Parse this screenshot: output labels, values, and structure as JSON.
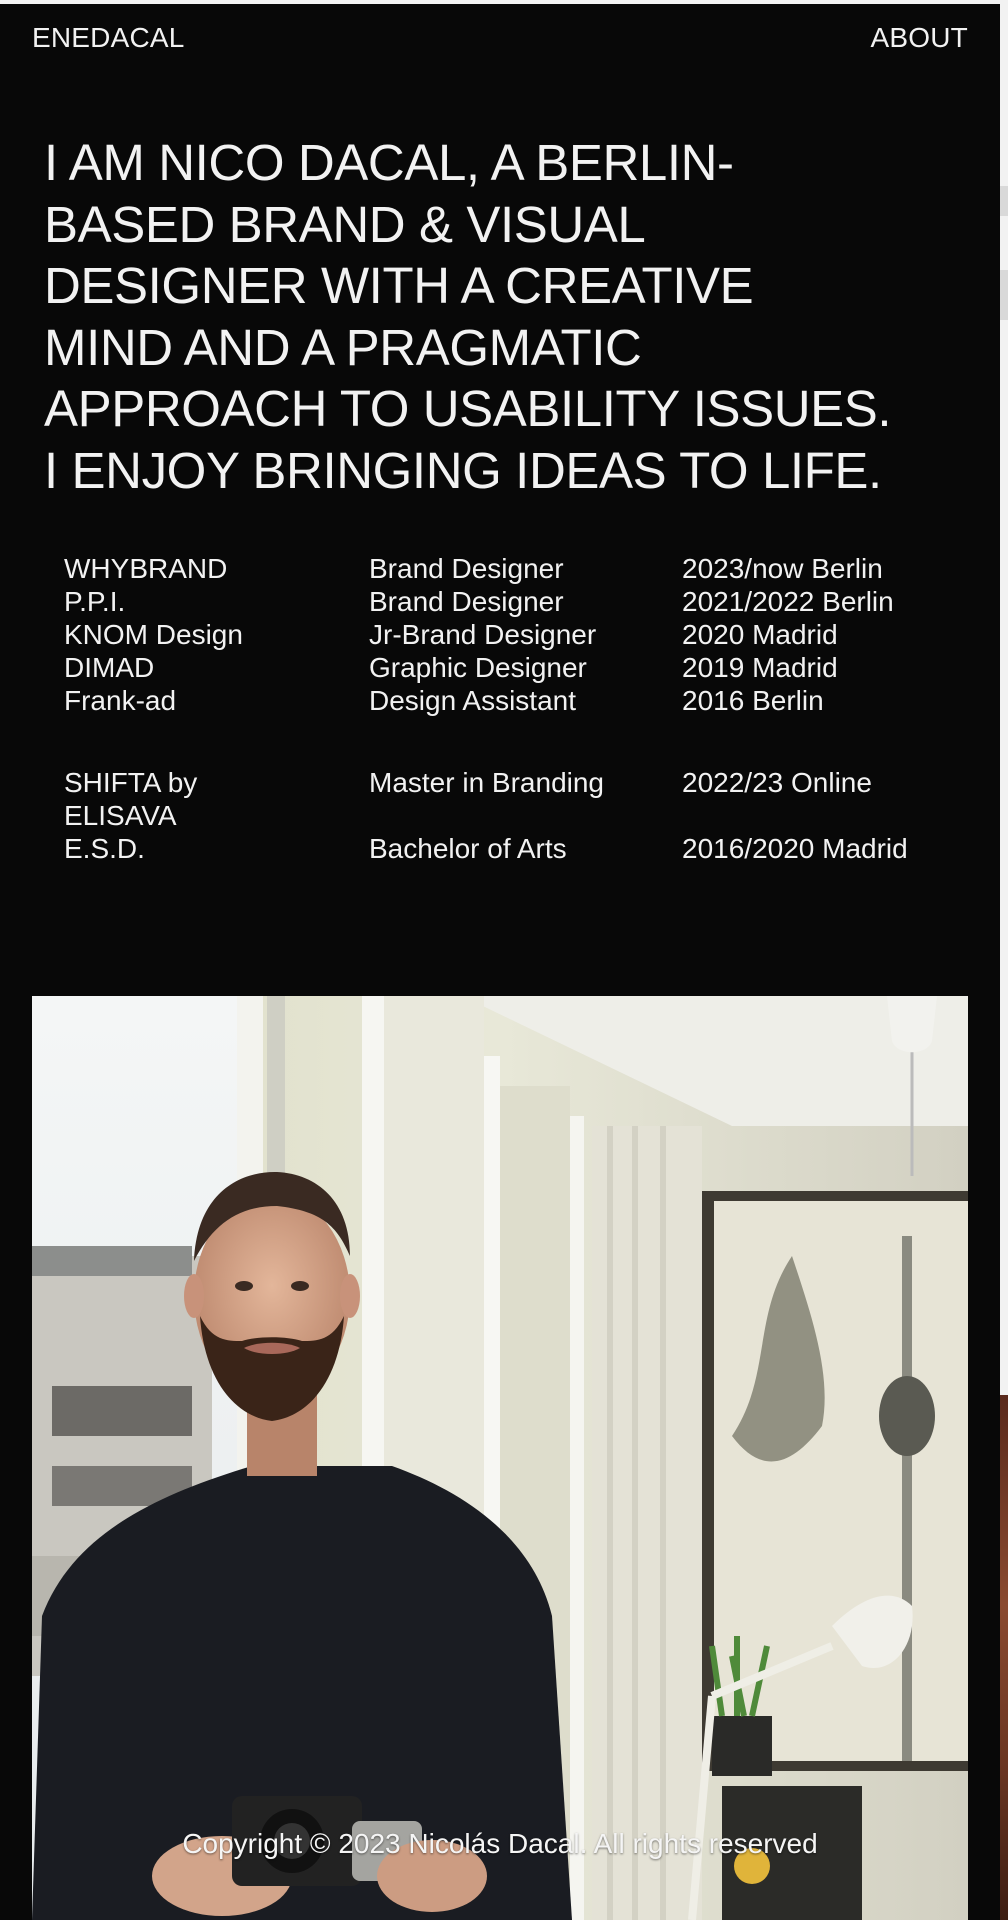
{
  "nav": {
    "logo": "ENEDACAL",
    "about": "ABOUT"
  },
  "intro": "I AM NICO DACAL, A BERLIN-\nBASED BRAND & VISUAL\nDESIGNER WITH A CREATIVE\nMIND AND A PRAGMATIC\nAPPROACH TO USABILITY ISSUES.\nI ENJOY BRINGING IDEAS TO LIFE.",
  "experience": [
    {
      "company": "WHYBRAND",
      "role": "Brand Designer",
      "period": "2023/now Berlin"
    },
    {
      "company": "P.P.I.",
      "role": "Brand Designer",
      "period": "2021/2022 Berlin"
    },
    {
      "company": "KNOM Design",
      "role": "Jr-Brand Designer",
      "period": "2020 Madrid"
    },
    {
      "company": "DIMAD",
      "role": "Graphic Designer",
      "period": "2019 Madrid"
    },
    {
      "company": "Frank-ad",
      "role": "Design Assistant",
      "period": "2016 Berlin"
    }
  ],
  "education": [
    {
      "school": "SHIFTA by\nELISAVA",
      "degree": "Master in Branding",
      "period": "2022/23 Online"
    },
    {
      "school": "E.S.D.",
      "degree": "Bachelor of Arts",
      "period": "2016/2020 Madrid"
    }
  ],
  "footer": {
    "copyright": "Copyright © 2023 Nicolás Dacal. All rights reserved"
  },
  "colors": {
    "panel_background": "#080808",
    "text": "#f2f2f2"
  }
}
